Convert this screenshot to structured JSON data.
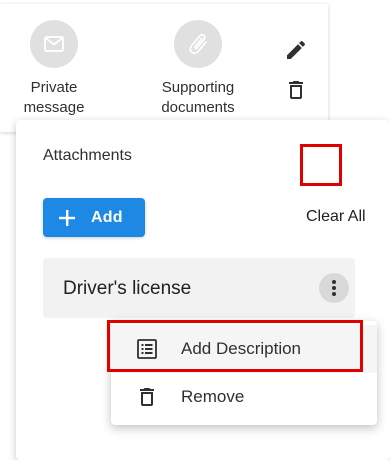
{
  "top_card": {
    "actions": [
      {
        "label": "Private\nmessage",
        "icon": "mail-icon"
      },
      {
        "label": "Supporting\ndocuments",
        "icon": "paperclip-icon"
      }
    ],
    "icons": [
      "edit-icon",
      "trash-icon"
    ]
  },
  "attachments": {
    "title": "Attachments",
    "add_label": "Add",
    "clear_all_label": "Clear All",
    "items": [
      {
        "name": "Driver's license"
      }
    ]
  },
  "menu": {
    "items": [
      {
        "label": "Add Description",
        "icon": "list-icon"
      },
      {
        "label": "Remove",
        "icon": "trash-icon"
      }
    ]
  },
  "colors": {
    "primary": "#1e88e5",
    "highlight": "#e00000",
    "circle_bg": "#e0e0e0",
    "row_bg": "#f2f2f2"
  }
}
